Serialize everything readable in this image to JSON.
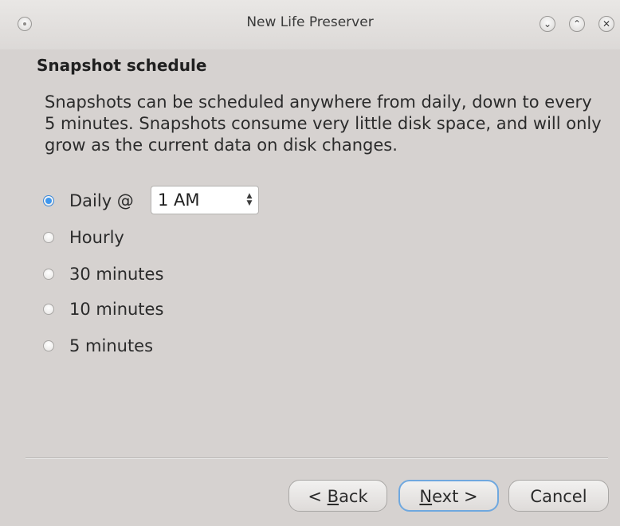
{
  "window": {
    "title": "New Life Preserver",
    "controls": [
      "minimize-icon",
      "maximize-icon",
      "close-icon"
    ]
  },
  "page": {
    "heading": "Snapshot schedule",
    "description": "Snapshots can be scheduled anywhere from daily, down to every 5 minutes. Snapshots consume very little disk space, and will only grow as the current data on disk changes."
  },
  "schedule": {
    "options": [
      {
        "label": "Daily @",
        "checked": true
      },
      {
        "label": "Hourly",
        "checked": false
      },
      {
        "label": "30 minutes",
        "checked": false
      },
      {
        "label": "10 minutes",
        "checked": false
      },
      {
        "label": "5 minutes",
        "checked": false
      }
    ],
    "daily_time": "1 AM"
  },
  "buttons": {
    "back": {
      "prefix": "< ",
      "mnemonic": "B",
      "rest": "ack"
    },
    "next": {
      "mnemonic": "N",
      "rest": "ext >"
    },
    "cancel": "Cancel"
  },
  "colors": {
    "accent": "#3f97ee",
    "default_button_border": "#6fa8df",
    "background": "#d6d2d0"
  }
}
